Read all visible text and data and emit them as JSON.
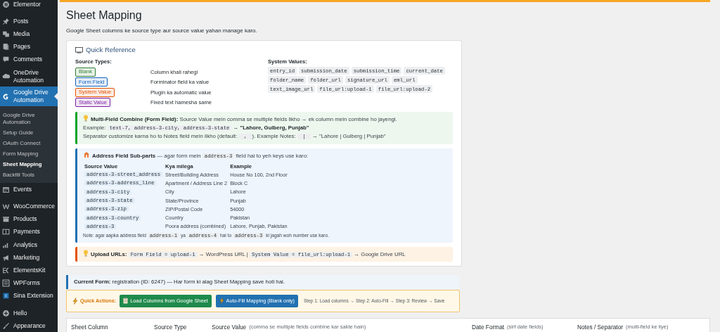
{
  "sidebar": {
    "groups": [
      [
        {
          "label": "Elementor",
          "selected": false
        }
      ],
      [
        {
          "label": "Posts",
          "selected": false
        },
        {
          "label": "Media",
          "selected": false
        },
        {
          "label": "Pages",
          "selected": false
        },
        {
          "label": "Comments",
          "selected": false
        },
        {
          "label": "OneDrive Automation",
          "selected": false
        },
        {
          "label": "Google Drive Automation",
          "selected": true,
          "children": [
            {
              "label": "Google Drive Automation",
              "selected": false
            },
            {
              "label": "Setup Guide",
              "selected": false
            },
            {
              "label": "OAuth Connect",
              "selected": false
            },
            {
              "label": "Form Mapping",
              "selected": false
            },
            {
              "label": "Sheet Mapping",
              "selected": true
            },
            {
              "label": "Backfill Tools",
              "selected": false
            }
          ]
        },
        {
          "label": "Events",
          "selected": false
        }
      ],
      [
        {
          "label": "WooCommerce",
          "selected": false
        },
        {
          "label": "Products",
          "selected": false
        },
        {
          "label": "Payments",
          "selected": false
        },
        {
          "label": "Analytics",
          "selected": false
        },
        {
          "label": "Marketing",
          "selected": false
        },
        {
          "label": "ElementsKit",
          "selected": false
        },
        {
          "label": "WPForms",
          "selected": false
        },
        {
          "label": "Sina Extension",
          "selected": false
        }
      ],
      [
        {
          "label": "Hello",
          "selected": false
        },
        {
          "label": "Appearance",
          "selected": false
        }
      ]
    ]
  },
  "page": {
    "title": "Sheet Mapping",
    "description": "Google Sheet columns ke source type aur source value yahan manage karo."
  },
  "quick_reference": {
    "title": "Quick Reference",
    "source_types_heading": "Source Types:",
    "source_types": [
      {
        "label": "Blank",
        "color": "#2e7d32",
        "description": "Column khali rahegi"
      },
      {
        "label": "Form Field",
        "color": "#1565c0",
        "description": "Forminator field ka value"
      },
      {
        "label": "System Value",
        "color": "#e65100",
        "description": "Plugin ka automatic value"
      },
      {
        "label": "Static Value",
        "color": "#7b1fa2",
        "description": "Fixed text hamesha same"
      }
    ],
    "system_values_heading": "System Values:",
    "system_values": [
      "entry_id",
      "submission_date",
      "submission_time",
      "current_date",
      "folder_name",
      "folder_url",
      "signature_url",
      "eml_url",
      "text_image_url",
      "file_url:upload-1",
      "file_url:upload-2"
    ],
    "callouts": [
      {
        "kind": "success",
        "lines": [
          [
            {
              "text": "**Multi-Field Combine (Form Field):** Source Value mein comma se multiple fields likho → ek column mein combine ho jayengi."
            }
          ],
          [
            {
              "text": "Example: "
            },
            {
              "code": "text-7, address-3-city, address-3-state"
            },
            {
              "text": " → **\"Lahore, Gulberg, Punjab\"**"
            }
          ],
          [
            {
              "text": "Separator customize karna ho to Notes field mein likho (default: "
            },
            {
              "code": " , "
            },
            {
              "text": "). Example Notes: "
            },
            {
              "code": " | "
            },
            {
              "text": " → \"Lahore | Gulberg | Punjab\""
            }
          ]
        ]
      },
      {
        "kind": "info",
        "lines": [
          [
            {
              "text": "**Address Field Sub-parts** — agar form mein "
            },
            {
              "code": "address-3"
            },
            {
              "text": " field hai to yeh keys use karo:"
            }
          ]
        ],
        "table": {
          "columns": [
            "Source Value",
            "Kya milega",
            "Example"
          ],
          "rows": [
            [
              "address-3-street_address",
              "Street/Building Address",
              "House No 100, 2nd Floor"
            ],
            [
              "address-3-address_line",
              "Apartment / Address Line 2",
              "Block C"
            ],
            [
              "address-3-city",
              "City",
              "Lahore"
            ],
            [
              "address-3-state",
              "State/Province",
              "Punjab"
            ],
            [
              "address-3-zip",
              "ZIP/Postal Code",
              "54000"
            ],
            [
              "address-3-country",
              "Country",
              "Pakistan"
            ],
            [
              "address-3",
              "Poora address (combined)",
              "Lahore, Punjab, Pakistan"
            ]
          ]
        },
        "note": [
          {
            "text": "Note: agar aapka address field "
          },
          {
            "code": "address-1"
          },
          {
            "text": " ya "
          },
          {
            "code": "address-4"
          },
          {
            "text": " hai to "
          },
          {
            "code": "address-3"
          },
          {
            "text": " ki jagah woh number use karo."
          }
        ]
      },
      {
        "kind": "warning",
        "lines": [
          [
            {
              "text": "**Upload URLs:** "
            },
            {
              "code": "Form Field = upload-1"
            },
            {
              "text": " → WordPress URL | "
            },
            {
              "code": "System Value = file_url:upload-1"
            },
            {
              "text": " → Google Drive URL"
            }
          ]
        ]
      }
    ]
  },
  "current_form": "**Current Form:** registration (ID: 6247) — Har form ki alag Sheet Mapping save hoti hai.",
  "quick_actions": {
    "label": "Quick Actions:",
    "buttons": [
      {
        "label": "Load Columns from Google Sheet",
        "kind": "success"
      },
      {
        "label": "Auto-Fill Mapping (Blank only)",
        "kind": "primary"
      }
    ],
    "steps": "Step 1: Load columns → Step 2: Auto-Fill → Step 3: Review → Save"
  },
  "mapping_table": {
    "columns": [
      {
        "label": "Sheet Column"
      },
      {
        "label": "Source Type"
      },
      {
        "label": "Source Value",
        "hint": "(comma se multiple fields combine kar sakte hain)"
      },
      {
        "label": "Date Format",
        "hint": "(sirf date fields)"
      },
      {
        "label": "Notes / Separator",
        "hint": "(multi-field ke liye)"
      }
    ]
  }
}
